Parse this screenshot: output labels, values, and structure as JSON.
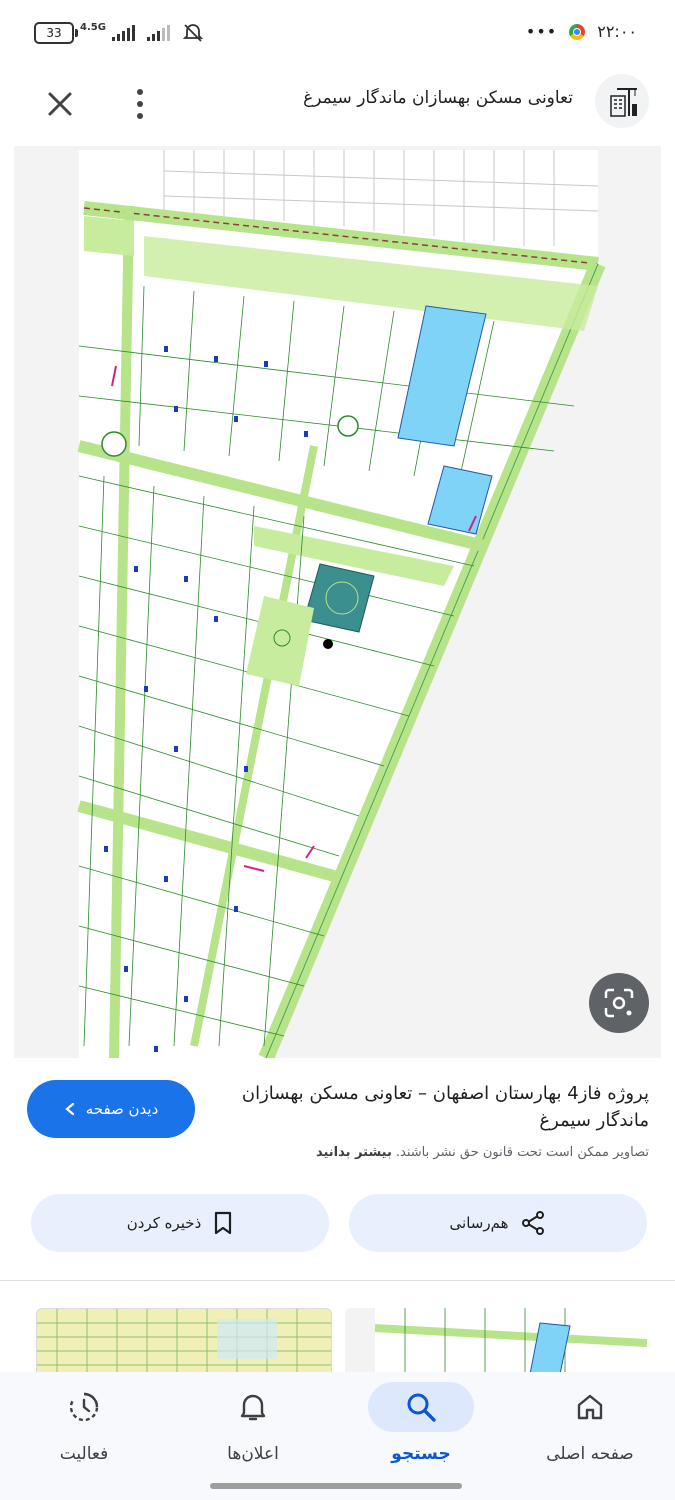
{
  "status_bar": {
    "time": "۲۲:۰۰",
    "battery": "33",
    "network": "4.5G",
    "dots": "•••"
  },
  "header": {
    "site_title": "تعاونی مسکن بهسازان ماندگار سیمرغ",
    "logo_icon": "building-crane-icon",
    "close_icon": "close-icon",
    "more_icon": "more-vert-icon"
  },
  "result": {
    "title": "پروژه فاز4 بهارستان اصفهان – تعاونی مسکن بهسازان ماندگار سیمرغ",
    "visit_label": "دیدن صفحه",
    "copyright_text": "تصاویر ممکن است تحت قانون حق نشر باشند.",
    "learn_more": "بیشتر بدانید"
  },
  "actions": {
    "share_label": "هم‌رسانی",
    "save_label": "ذخیره کردن"
  },
  "nav": {
    "items": [
      {
        "label": "صفحه اصلی",
        "icon": "home-icon",
        "active": false
      },
      {
        "label": "جستجو",
        "icon": "search-icon",
        "active": true
      },
      {
        "label": "اعلان‌ها",
        "icon": "bell-icon",
        "active": false
      },
      {
        "label": "فعالیت",
        "icon": "activity-icon",
        "active": false
      }
    ]
  },
  "colors": {
    "accent": "#1a73e8",
    "tonal": "#e8f0fe",
    "map_green": "#b7e48a",
    "map_blue": "#7fd3f7"
  }
}
